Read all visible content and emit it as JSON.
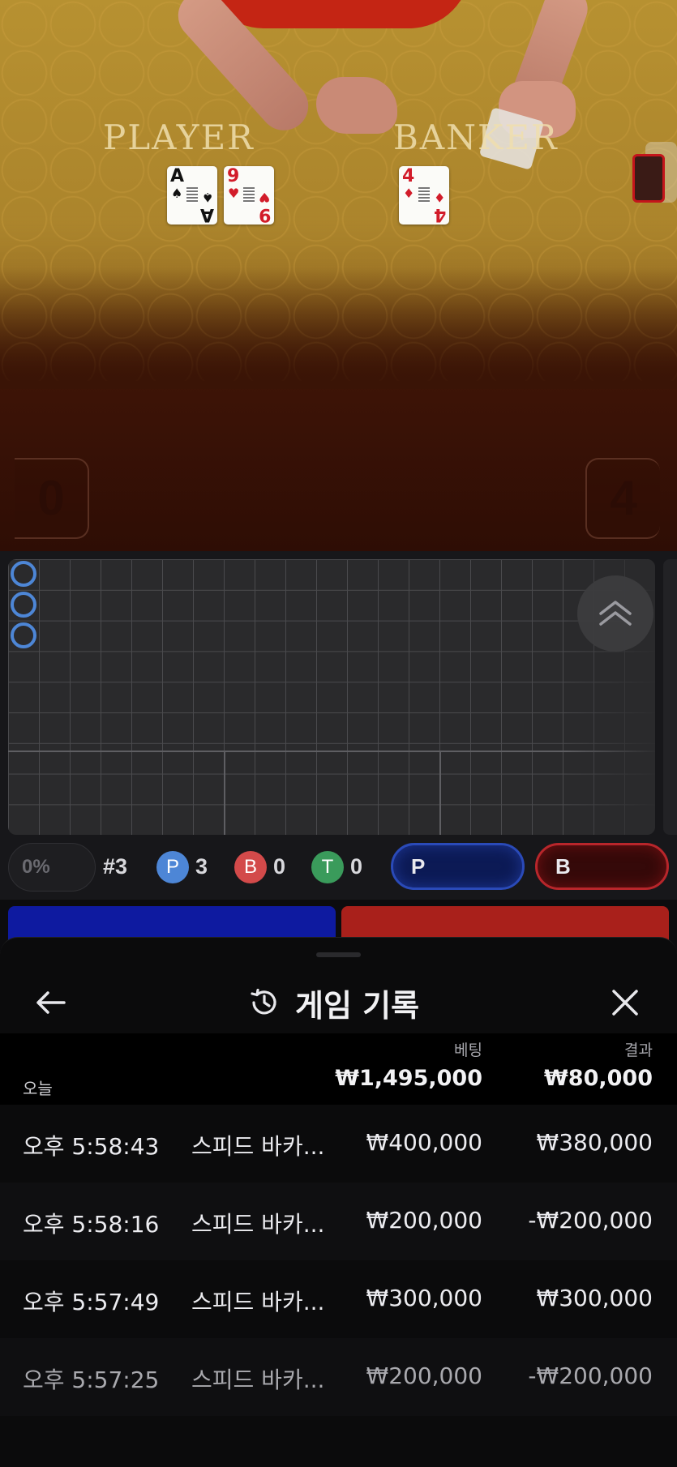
{
  "video": {
    "player_label": "PLAYER",
    "banker_label": "BANKER",
    "player_cards": [
      {
        "rank": "A",
        "suit": "♠",
        "color": "black"
      },
      {
        "rank": "9",
        "suit": "♥",
        "color": "red"
      }
    ],
    "banker_cards": [
      {
        "rank": "4",
        "suit": "♦",
        "color": "red"
      }
    ],
    "player_score": "0",
    "banker_score": "4"
  },
  "roadmap": {
    "results": [
      "P",
      "P",
      "P"
    ],
    "stats": {
      "percent": "0%",
      "round": "#3",
      "player_badge": "P",
      "player_count": "3",
      "banker_badge": "B",
      "banker_count": "0",
      "tie_badge": "T",
      "tie_count": "0"
    },
    "predict_player": "P",
    "predict_banker": "B"
  },
  "history": {
    "title": "게임 기록",
    "column_bet": "베팅",
    "column_result": "결과",
    "today_label": "오늘",
    "total_bet": "₩1,495,000",
    "total_result": "₩80,000",
    "rows": [
      {
        "time": "오후 5:58:43",
        "game": "스피드 바카...",
        "bet": "₩400,000",
        "result": "₩380,000"
      },
      {
        "time": "오후 5:58:16",
        "game": "스피드 바카...",
        "bet": "₩200,000",
        "result": "-₩200,000"
      },
      {
        "time": "오후 5:57:49",
        "game": "스피드 바카...",
        "bet": "₩300,000",
        "result": "₩300,000"
      },
      {
        "time": "오후 5:57:25",
        "game": "스피드 바카...",
        "bet": "₩200,000",
        "result": "-₩200,000"
      }
    ]
  },
  "colors": {
    "player_blue": "#4d86d6",
    "banker_red": "#d34a4a",
    "tie_green": "#3a9b5b"
  },
  "icons": {
    "back": "arrow-left-icon",
    "history": "history-clock-icon",
    "close": "close-icon",
    "expand": "double-chevron-up-icon"
  }
}
